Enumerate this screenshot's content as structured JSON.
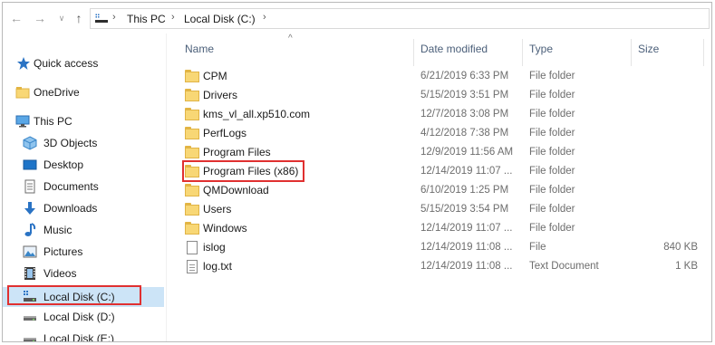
{
  "toolbar": {
    "back_glyph": "←",
    "forward_glyph": "→",
    "recent_glyph": "∨",
    "up_glyph": "↑"
  },
  "address": {
    "segments": [
      "This PC",
      "Local Disk (C:)"
    ],
    "separator": "›"
  },
  "sidebar": {
    "items": [
      {
        "label": "Quick access",
        "icon": "star-icon"
      },
      {
        "label": "OneDrive",
        "icon": "onedrive-folder-icon"
      },
      {
        "label": "This PC",
        "icon": "pc-icon"
      },
      {
        "label": "3D Objects",
        "icon": "3d-objects-icon"
      },
      {
        "label": "Desktop",
        "icon": "desktop-icon"
      },
      {
        "label": "Documents",
        "icon": "documents-icon"
      },
      {
        "label": "Downloads",
        "icon": "downloads-icon"
      },
      {
        "label": "Music",
        "icon": "music-icon"
      },
      {
        "label": "Pictures",
        "icon": "pictures-icon"
      },
      {
        "label": "Videos",
        "icon": "videos-icon"
      },
      {
        "label": "Local Disk (C:)",
        "icon": "drive-c-icon"
      },
      {
        "label": "Local Disk (D:)",
        "icon": "drive-icon"
      },
      {
        "label": "Local Disk (E:)",
        "icon": "drive-icon"
      }
    ]
  },
  "columns": {
    "name": "Name",
    "date": "Date modified",
    "type": "Type",
    "size": "Size"
  },
  "files": [
    {
      "name": "CPM",
      "date": "6/21/2019 6:33 PM",
      "type": "File folder",
      "size": "",
      "icon": "folder-icon"
    },
    {
      "name": "Drivers",
      "date": "5/15/2019 3:51 PM",
      "type": "File folder",
      "size": "",
      "icon": "folder-icon"
    },
    {
      "name": "kms_vl_all.xp510.com",
      "date": "12/7/2018 3:08 PM",
      "type": "File folder",
      "size": "",
      "icon": "folder-icon"
    },
    {
      "name": "PerfLogs",
      "date": "4/12/2018 7:38 PM",
      "type": "File folder",
      "size": "",
      "icon": "folder-icon"
    },
    {
      "name": "Program Files",
      "date": "12/9/2019 11:56 AM",
      "type": "File folder",
      "size": "",
      "icon": "folder-icon"
    },
    {
      "name": "Program Files (x86)",
      "date": "12/14/2019 11:07 ...",
      "type": "File folder",
      "size": "",
      "icon": "folder-icon"
    },
    {
      "name": "QMDownload",
      "date": "6/10/2019 1:25 PM",
      "type": "File folder",
      "size": "",
      "icon": "folder-icon"
    },
    {
      "name": "Users",
      "date": "5/15/2019 3:54 PM",
      "type": "File folder",
      "size": "",
      "icon": "folder-icon"
    },
    {
      "name": "Windows",
      "date": "12/14/2019 11:07 ...",
      "type": "File folder",
      "size": "",
      "icon": "folder-icon"
    },
    {
      "name": "islog",
      "date": "12/14/2019 11:08 ...",
      "type": "File",
      "size": "840 KB",
      "icon": "file-icon"
    },
    {
      "name": "log.txt",
      "date": "12/14/2019 11:08 ...",
      "type": "Text Document",
      "size": "1 KB",
      "icon": "text-file-icon"
    }
  ],
  "colors": {
    "accent_highlight": "#e03030",
    "selected_bg": "#cce4f7",
    "folder": "#f8d775"
  }
}
